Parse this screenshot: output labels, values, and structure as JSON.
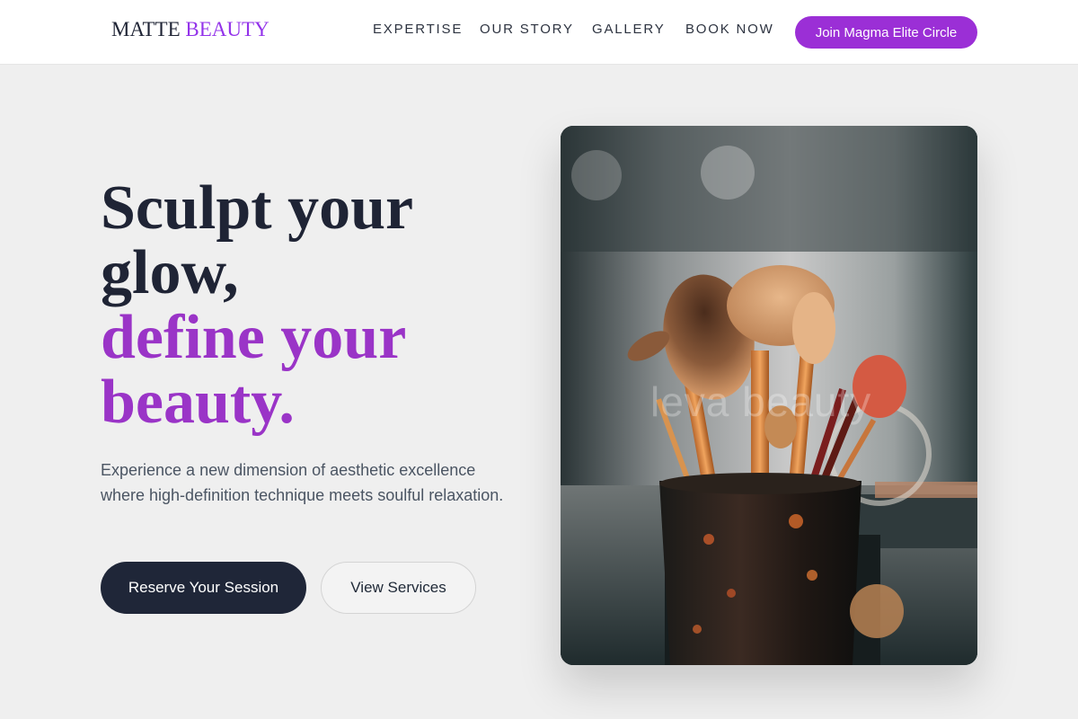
{
  "brand": {
    "name_part1": "MATTE",
    "name_part2": "BEAUTY",
    "accent_color": "#9b2fd6",
    "dark_color": "#1f2638"
  },
  "nav": {
    "links": [
      "EXPERTISE",
      "OUR STORY",
      "GALLERY",
      "BOOK NOW"
    ],
    "cta_label": "Join Magma Elite Circle"
  },
  "hero": {
    "title_line1": "Sculpt your",
    "title_line2": "glow,",
    "title_line3": "define your",
    "title_line4": "beauty.",
    "subtitle": "Experience a new dimension of aesthetic excellence where high-definition technique meets soulful relaxation.",
    "primary_button": "Reserve Your Session",
    "secondary_button": "View Services"
  },
  "image": {
    "watermark": "leva beauty"
  }
}
